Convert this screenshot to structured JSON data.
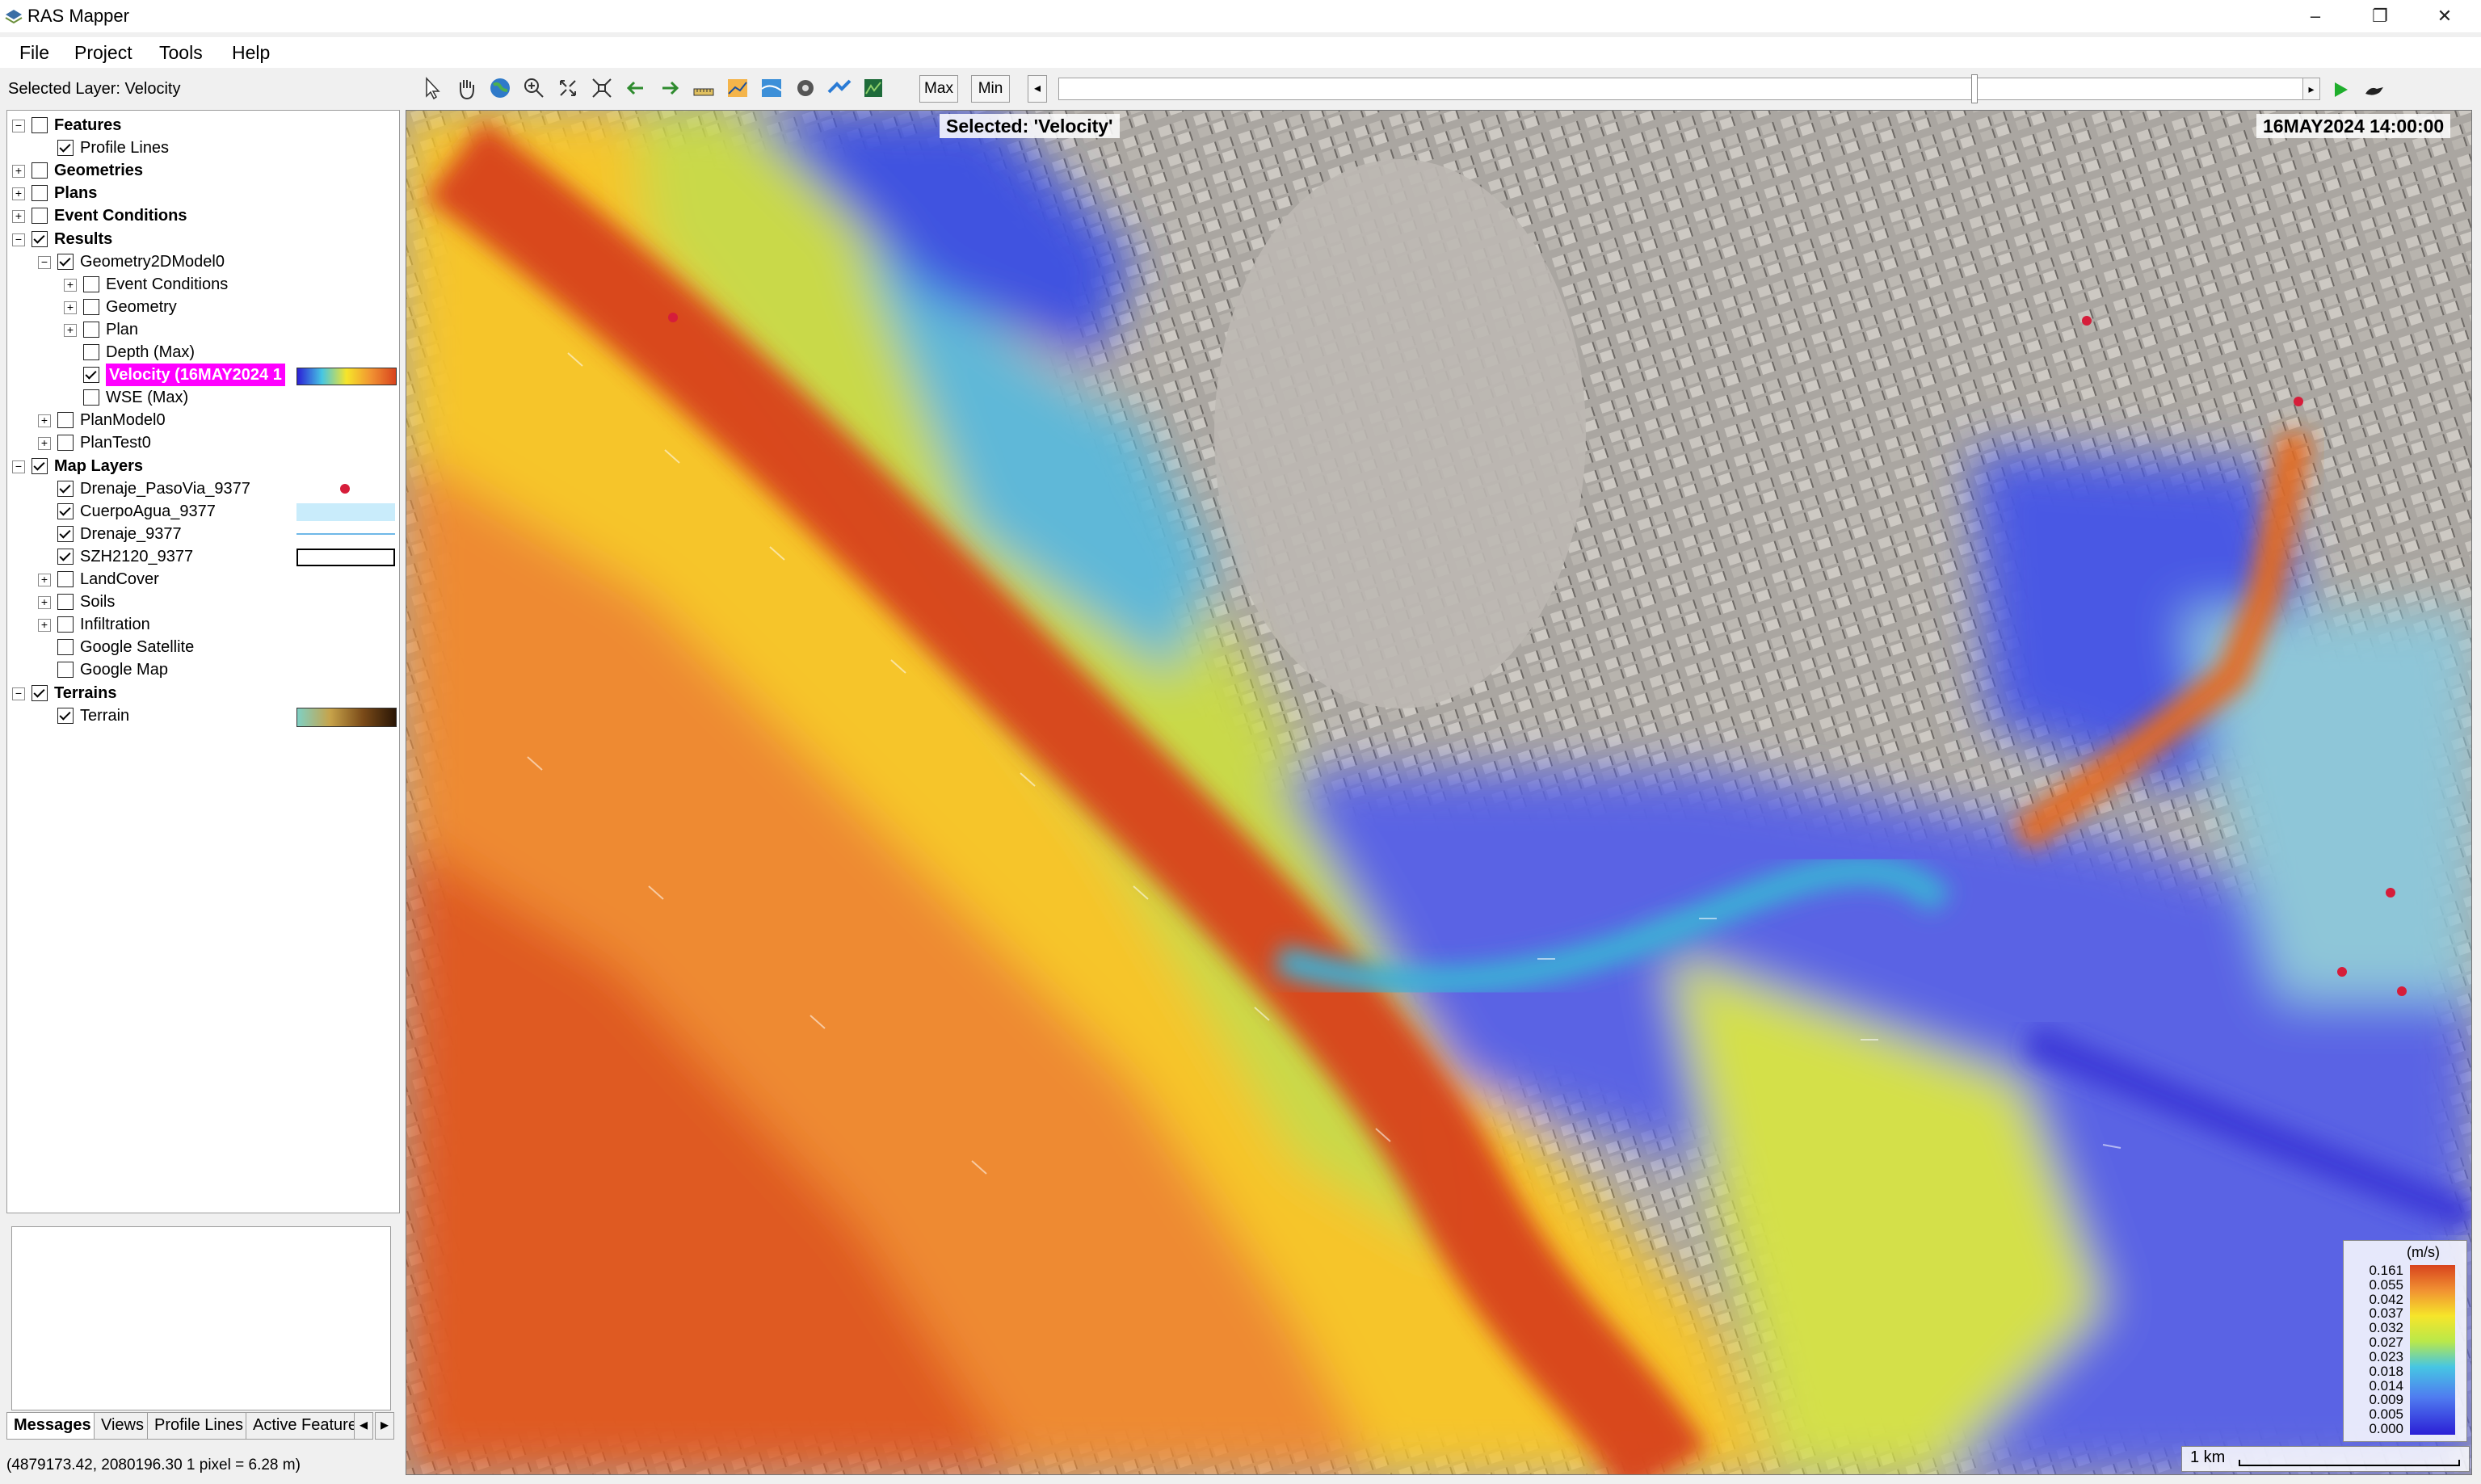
{
  "window": {
    "title": "RAS Mapper",
    "min": "–",
    "restore": "❐",
    "close": "✕"
  },
  "menu": [
    "File",
    "Project",
    "Tools",
    "Help"
  ],
  "selected_layer_text": "Selected Layer: Velocity",
  "toolbar": {
    "max_label": "Max",
    "min_label": "Min",
    "icons": [
      "pointer-icon",
      "pan-hand-icon",
      "globe-icon",
      "zoom-in-icon",
      "zoom-extents-icon",
      "full-extent-icon",
      "back-arrow-icon",
      "forward-arrow-icon",
      "measure-icon",
      "profile-plot-icon",
      "map-icon",
      "layers-icon",
      "data-icon",
      "database-icon",
      "terrain-icon"
    ]
  },
  "tree": [
    {
      "label": "Features",
      "bold": true,
      "checked": false,
      "level": 0,
      "expander": "−"
    },
    {
      "label": "Profile Lines",
      "checked": true,
      "level": 1
    },
    {
      "label": "Geometries",
      "bold": true,
      "checked": false,
      "level": 0,
      "expander": "+"
    },
    {
      "label": "Plans",
      "bold": true,
      "checked": false,
      "level": 0,
      "expander": "+"
    },
    {
      "label": "Event Conditions",
      "bold": true,
      "checked": false,
      "level": 0,
      "expander": "+"
    },
    {
      "label": "Results",
      "bold": true,
      "checked": true,
      "level": 0,
      "expander": "−"
    },
    {
      "label": "Geometry2DModel0",
      "checked": true,
      "level": 1,
      "expander": "−"
    },
    {
      "label": "Event Conditions",
      "checked": false,
      "level": 2,
      "expander": "+"
    },
    {
      "label": "Geometry",
      "checked": false,
      "level": 2,
      "expander": "+"
    },
    {
      "label": "Plan",
      "checked": false,
      "level": 2,
      "expander": "+"
    },
    {
      "label": "Depth (Max)",
      "checked": false,
      "level": 2
    },
    {
      "label": "Velocity (16MAY2024 1",
      "checked": true,
      "level": 2,
      "selected": true,
      "swatch": "velocity"
    },
    {
      "label": "WSE (Max)",
      "checked": false,
      "level": 2
    },
    {
      "label": "PlanModel0",
      "checked": false,
      "level": 1,
      "expander": "+"
    },
    {
      "label": "PlanTest0",
      "checked": false,
      "level": 1,
      "expander": "+"
    },
    {
      "label": "Map Layers",
      "bold": true,
      "checked": true,
      "level": 0,
      "expander": "−"
    },
    {
      "label": "Drenaje_PasoVia_9377",
      "checked": true,
      "level": 1,
      "swatch": "dot"
    },
    {
      "label": "CuerpoAgua_9377",
      "checked": true,
      "level": 1,
      "swatch": "water"
    },
    {
      "label": "Drenaje_9377",
      "checked": true,
      "level": 1,
      "swatch": "line"
    },
    {
      "label": "SZH2120_9377",
      "checked": true,
      "level": 1,
      "swatch": "box"
    },
    {
      "label": "LandCover",
      "checked": false,
      "level": 1,
      "expander": "+"
    },
    {
      "label": "Soils",
      "checked": false,
      "level": 1,
      "expander": "+"
    },
    {
      "label": "Infiltration",
      "checked": false,
      "level": 1,
      "expander": "+"
    },
    {
      "label": "Google Satellite",
      "checked": false,
      "level": 1
    },
    {
      "label": "Google Map",
      "checked": false,
      "level": 1
    },
    {
      "label": "Terrains",
      "bold": true,
      "checked": true,
      "level": 0,
      "expander": "−"
    },
    {
      "label": "Terrain",
      "checked": true,
      "level": 1,
      "swatch": "terrain"
    }
  ],
  "bottom_tabs": [
    "Messages",
    "Views",
    "Profile Lines",
    "Active Feature"
  ],
  "status_text": "(4879173.42, 2080196.30  1 pixel = 6.28 m)",
  "map": {
    "selected_label": "Selected: 'Velocity'",
    "time_label": "16MAY2024 14:00:00",
    "legend": {
      "unit": "(m/s)",
      "ticks": [
        "0.161",
        "0.055",
        "0.042",
        "0.037",
        "0.032",
        "0.027",
        "0.023",
        "0.018",
        "0.014",
        "0.009",
        "0.005",
        "0.000"
      ]
    },
    "scale_label": "1 km"
  },
  "colors": {
    "velocity_high": "#d8431e",
    "velocity_mid": "#f6e52a",
    "velocity_low": "#3a3fd6",
    "terrain": "#a8a49f",
    "selection": "#ff00ff"
  }
}
